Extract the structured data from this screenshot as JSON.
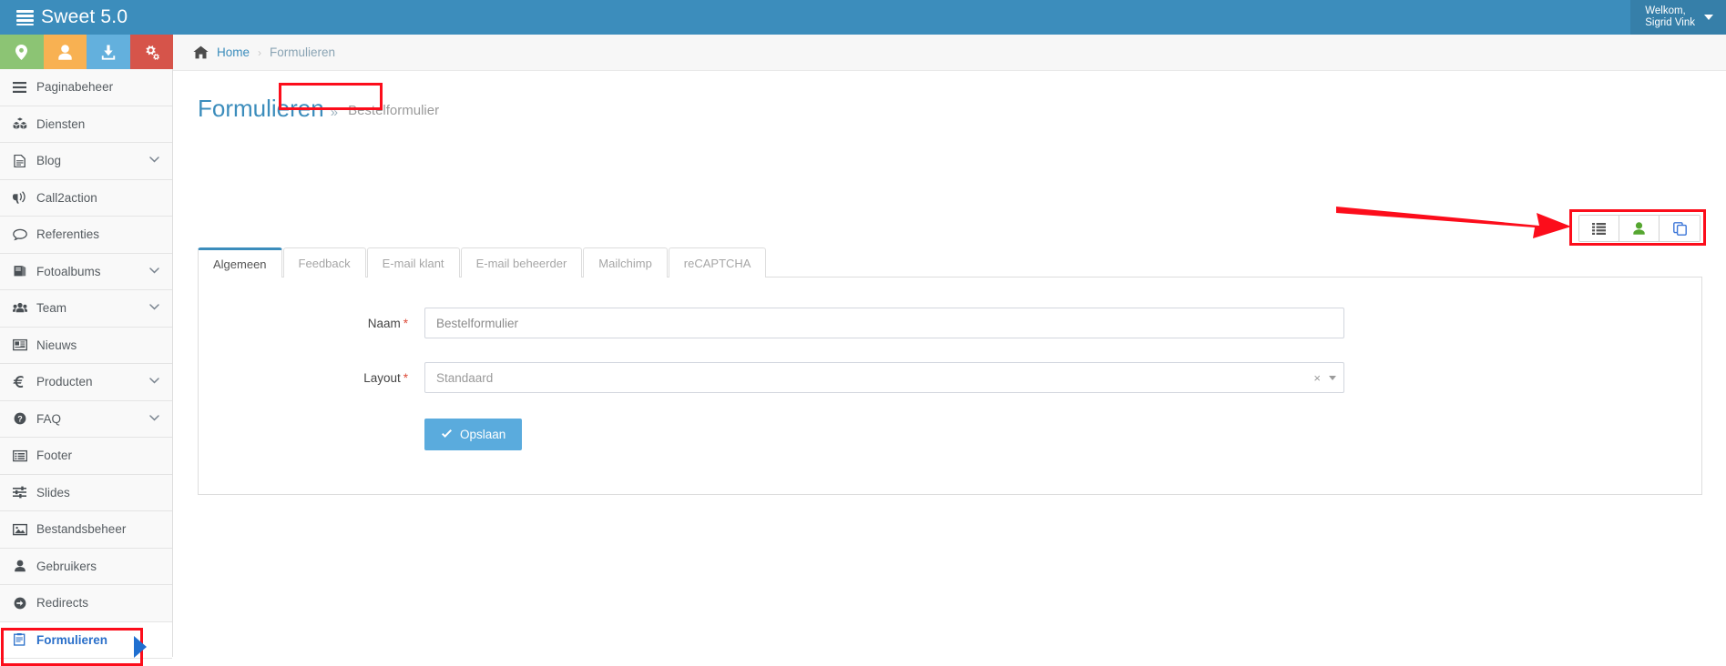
{
  "app": {
    "title": "Sweet 5.0",
    "logo_icon": "server-stack-icon",
    "brand_color": "#3c8dbc"
  },
  "user_menu": {
    "greeting": "Welkom,",
    "name": "Sigrid Vink",
    "caret_icon": "caret-down-icon"
  },
  "breadcrumb": {
    "home_icon": "home-icon",
    "home": "Home",
    "separator": "›",
    "current": "Formulieren"
  },
  "sidebar": {
    "quick_actions": [
      {
        "name": "map-marker-button",
        "icon": "map-marker-icon",
        "color": "#8cc474"
      },
      {
        "name": "user-button",
        "icon": "user-icon",
        "color": "#f8b152"
      },
      {
        "name": "download-button",
        "icon": "download-icon",
        "color": "#63b0dd"
      },
      {
        "name": "settings-button",
        "icon": "cogs-icon",
        "color": "#d6544a"
      }
    ],
    "items": [
      {
        "label": "Paginabeheer",
        "icon": "bars-icon",
        "chevron": false,
        "active": false
      },
      {
        "label": "Diensten",
        "icon": "cubes-icon",
        "chevron": false,
        "active": false
      },
      {
        "label": "Blog",
        "icon": "file-text-icon",
        "chevron": true,
        "active": false
      },
      {
        "label": "Call2action",
        "icon": "bullhorn-icon",
        "chevron": false,
        "active": false
      },
      {
        "label": "Referenties",
        "icon": "comment-icon",
        "chevron": false,
        "active": false
      },
      {
        "label": "Fotoalbums",
        "icon": "book-icon",
        "chevron": true,
        "active": false
      },
      {
        "label": "Team",
        "icon": "users-icon",
        "chevron": true,
        "active": false
      },
      {
        "label": "Nieuws",
        "icon": "newspaper-icon",
        "chevron": false,
        "active": false
      },
      {
        "label": "Producten",
        "icon": "euro-icon",
        "chevron": true,
        "active": false
      },
      {
        "label": "FAQ",
        "icon": "question-circle-icon",
        "chevron": true,
        "active": false
      },
      {
        "label": "Footer",
        "icon": "list-alt-icon",
        "chevron": false,
        "active": false
      },
      {
        "label": "Slides",
        "icon": "sliders-icon",
        "chevron": false,
        "active": false
      },
      {
        "label": "Bestandsbeheer",
        "icon": "image-icon",
        "chevron": false,
        "active": false
      },
      {
        "label": "Gebruikers",
        "icon": "user-icon",
        "chevron": false,
        "active": false
      },
      {
        "label": "Redirects",
        "icon": "arrow-circle-right-icon",
        "chevron": false,
        "active": false
      },
      {
        "label": "Formulieren",
        "icon": "clipboard-icon",
        "chevron": false,
        "active": true
      }
    ]
  },
  "page": {
    "title": "Formulieren",
    "title_separator": "»",
    "subtitle": "Bestelformulier"
  },
  "actions": [
    {
      "name": "list-view-button",
      "icon": "list-ul-icon",
      "color": "#555555"
    },
    {
      "name": "user-view-button",
      "icon": "user-icon",
      "color": "#55a630"
    },
    {
      "name": "duplicate-button",
      "icon": "copy-icon",
      "color": "#3c76d8"
    }
  ],
  "tabs": [
    {
      "label": "Algemeen",
      "active": true
    },
    {
      "label": "Feedback",
      "active": false
    },
    {
      "label": "E-mail klant",
      "active": false
    },
    {
      "label": "E-mail beheerder",
      "active": false
    },
    {
      "label": "Mailchimp",
      "active": false
    },
    {
      "label": "reCAPTCHA",
      "active": false
    }
  ],
  "form": {
    "naam": {
      "label": "Naam",
      "required_marker": "*",
      "value": "Bestelformulier",
      "placeholder": "Bestelformulier"
    },
    "layout": {
      "label": "Layout",
      "required_marker": "*",
      "value": "Standaard",
      "clear_icon": "×",
      "arrow_icon": "caret-down-icon"
    },
    "save": {
      "label": "Opslaan",
      "icon": "check-icon"
    }
  },
  "annotations": {
    "highlight_color": "#fc0d1b",
    "arrow_color": "#fc0d1b",
    "pointer_color": "#1f6fd0"
  }
}
